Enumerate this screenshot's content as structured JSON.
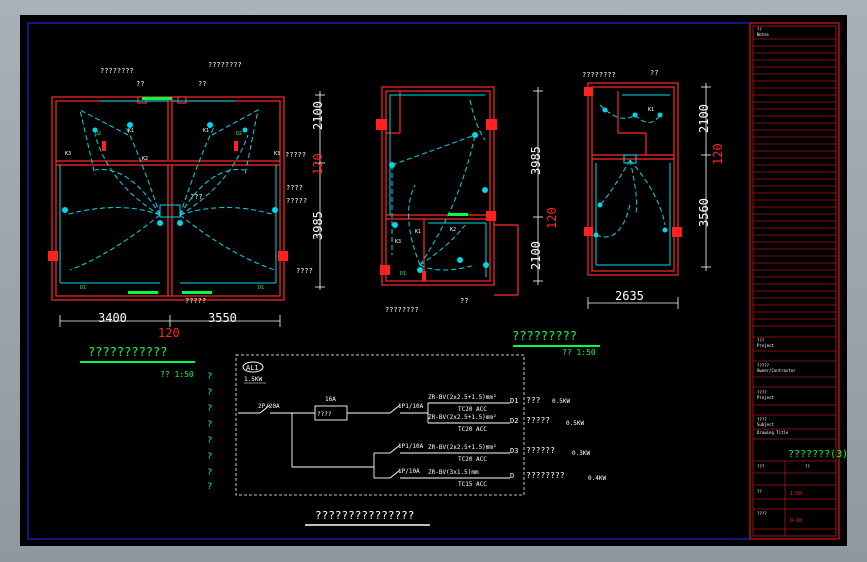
{
  "colors": {
    "background": "#000000",
    "frame": "#2a2aff",
    "wall": "#ff2a2a",
    "fixture": "#ff2020",
    "wiring": "#00d8e8",
    "label": "#ffffff",
    "dimension": "#ffffff",
    "note": "#00ff44",
    "title_block": "#ff2020"
  },
  "plan1": {
    "label_top_left": "????????",
    "label_top_right": "????????",
    "label_mid1": "??",
    "label_mid2": "??",
    "room_tag_l": "K1",
    "room_tag_r": "K1",
    "tag_k3_left": "K3",
    "tag_k3_right": "K3",
    "tag_k2": "K2",
    "tag_k1_left": "K1",
    "tag_d2_left": "D2",
    "tag_d2_right": "D2",
    "tag_d1_left": "D1",
    "tag_d1_right": "D1",
    "callout_r1": "?????",
    "callout_r2": "????",
    "callout_r3": "?????",
    "callout_r4": "????",
    "callout_center": "???",
    "callout_bottom": "?????",
    "dim_v_top": "2100",
    "dim_v_bottom": "3985",
    "dim_v_side": "120",
    "dim_h_left": "3400",
    "dim_h_right": "3550",
    "dim_h_mid": "120",
    "title": "???????????",
    "scale": "?? 1:50"
  },
  "plan2": {
    "dim_v_top": "3985",
    "dim_v_bottom": "2100",
    "dim_v_side": "120",
    "tag_k1": "K1",
    "tag_k2": "K2",
    "tag_k3": "K3",
    "tag_d1": "D1",
    "callout_bottom": "????????",
    "callout_bottom_r": "??",
    "title": "?????????",
    "scale": "?? 1:50"
  },
  "plan3": {
    "callout_top": "????????",
    "callout_top_r": "??",
    "dim_v_top": "2100",
    "dim_v_bottom": "3560",
    "dim_v_side": "120",
    "dim_h": "2635",
    "tag_k1": "K1"
  },
  "schematic": {
    "box_id": "AL1",
    "box_load": "1.5KW",
    "main_breaker": "2P/20A",
    "rcd_rating": "16A",
    "rcd_label": "????",
    "branch1_breaker": "1P1/10A",
    "branch1_cable": "ZR-BV(2x2.5+1.5)mm²",
    "branch1_conduit": "TC20 ACC",
    "branch1_id": "D1",
    "branch1_desc": "???",
    "branch1_load": "0.5KW",
    "branch2_cable": "ZR-BV(2x2.5+1.5)mm²",
    "branch2_conduit": "TC20 ACC",
    "branch2_id": "D2",
    "branch2_desc": "?????",
    "branch2_load": "0.5KW",
    "branch3_breaker": "1P1/10A",
    "branch3_cable": "ZR-BV(2x2.5+1.5)mm²",
    "branch3_conduit": "TC20 ACC",
    "branch3_id": "D3",
    "branch3_desc": "??????",
    "branch3_load": "0.3KW",
    "branch4_breaker": "1P/10A",
    "branch4_cable": "ZR-BV(3x1.5)mm",
    "branch4_conduit": "TC15 ACC",
    "branch4_id": "D",
    "branch4_desc": "????????",
    "branch4_load": "0.4KW",
    "notes": [
      "?",
      "?",
      "?",
      "?",
      "?",
      "?",
      "?",
      "?"
    ],
    "title": "???????????????"
  },
  "title_block": {
    "row_labels": [
      "??",
      "Notes",
      "???",
      "Project",
      "?????",
      "Owner/Contractor",
      "????",
      "Project",
      "????",
      "Subject",
      "Drawing Title"
    ],
    "drawing_name": "???????(3)",
    "date_label": "???",
    "date_val": "??",
    "scale_label": "??",
    "scale_val": "1:50",
    "sheet_no_label": "????",
    "sheet_no": "D-10"
  }
}
